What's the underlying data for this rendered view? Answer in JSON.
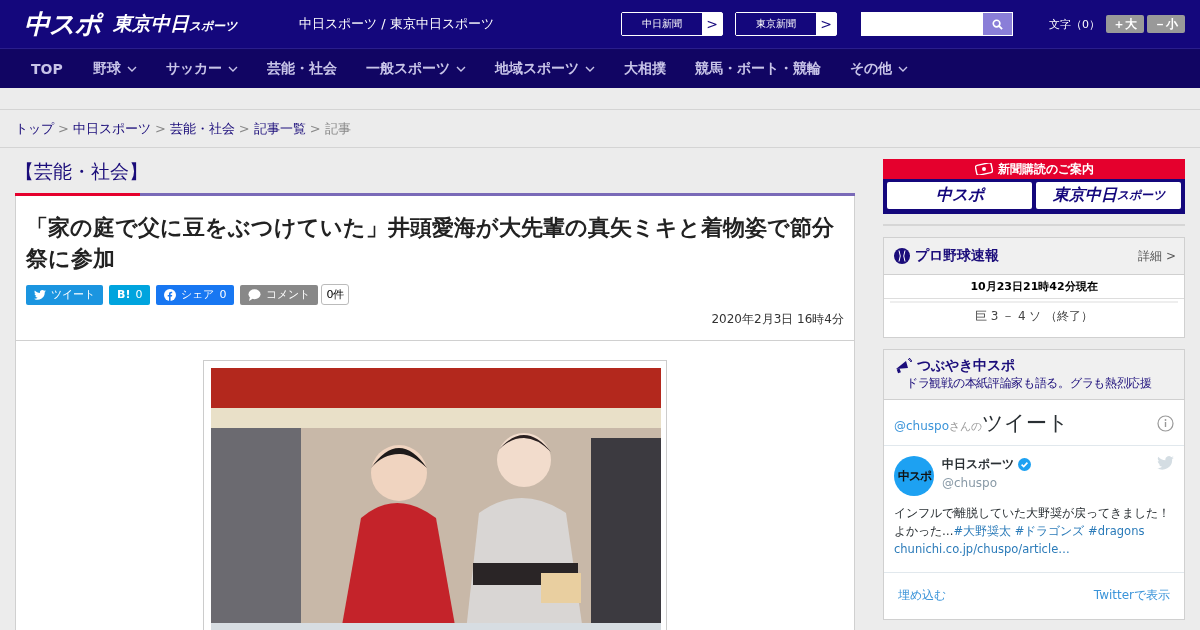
{
  "header": {
    "logo_main": "中スポ",
    "logo_sub": "東京中日",
    "logo_sub_small": "スポーツ",
    "site_title": "中日スポーツ / 東京中日スポーツ",
    "paper_links": [
      {
        "label": "中日新聞",
        "arrow": ">"
      },
      {
        "label": "東京新聞",
        "arrow": ">"
      }
    ],
    "font_size": {
      "label": "文字（0）",
      "buttons": [
        "＋大",
        "－小"
      ]
    }
  },
  "nav": [
    {
      "label": "TOP",
      "dropdown": false
    },
    {
      "label": "野球",
      "dropdown": true
    },
    {
      "label": "サッカー",
      "dropdown": true
    },
    {
      "label": "芸能・社会",
      "dropdown": false
    },
    {
      "label": "一般スポーツ",
      "dropdown": true
    },
    {
      "label": "地域スポーツ",
      "dropdown": true
    },
    {
      "label": "大相撲",
      "dropdown": false
    },
    {
      "label": "競馬・ボート・競輪",
      "dropdown": false
    },
    {
      "label": "その他",
      "dropdown": true
    }
  ],
  "breadcrumb": [
    {
      "label": "トップ",
      "link": true
    },
    {
      "label": "中日スポーツ",
      "link": true
    },
    {
      "label": "芸能・社会",
      "link": true
    },
    {
      "label": "記事一覧",
      "link": true
    },
    {
      "label": "記事",
      "link": false
    }
  ],
  "category": "【芸能・社会】",
  "article": {
    "title": "「家の庭で父に豆をぶつけていた」井頭愛海が大先輩の真矢ミキと着物姿で節分祭に参加",
    "share": [
      {
        "kind": "twitter",
        "label": "ツイート"
      },
      {
        "kind": "hatena",
        "label": "B!",
        "count": "0"
      },
      {
        "kind": "facebook",
        "label": "シェア",
        "count": "0"
      },
      {
        "kind": "comment",
        "label": "コメント"
      }
    ],
    "comment_count": "0件",
    "date": "2020年2月3日 16時4分"
  },
  "sidebar": {
    "subscription": {
      "title": "新聞購読のご案内",
      "logos": [
        {
          "main": "中スポ"
        },
        {
          "main": "東京中日",
          "small": "スポーツ"
        }
      ]
    },
    "baseball": {
      "title": "プロ野球速報",
      "more": "詳細 >",
      "time": "10月23日21時42分現在",
      "score": "巨 3 － 4 ソ （終了）"
    },
    "tweets": {
      "title": "つぶやき中スポ",
      "subtitle": "ドラ観戦の本紙評論家も語る。グラも熱烈応援",
      "handle": "@chuspo",
      "handle_suffix": "さんの",
      "heading": "ツイート",
      "user_name": "中日スポーツ",
      "verified": true,
      "user_handle": "@chuspo",
      "avatar_text": "中スポ",
      "text": "インフルで離脱していた大野奨が戻ってきました！よかった…",
      "links": [
        "#大野奨太",
        "#ドラゴンズ",
        "#dragons",
        "chunichi.co.jp/chuspo/article…"
      ],
      "footer": [
        "埋め込む",
        "Twitterで表示"
      ]
    }
  }
}
